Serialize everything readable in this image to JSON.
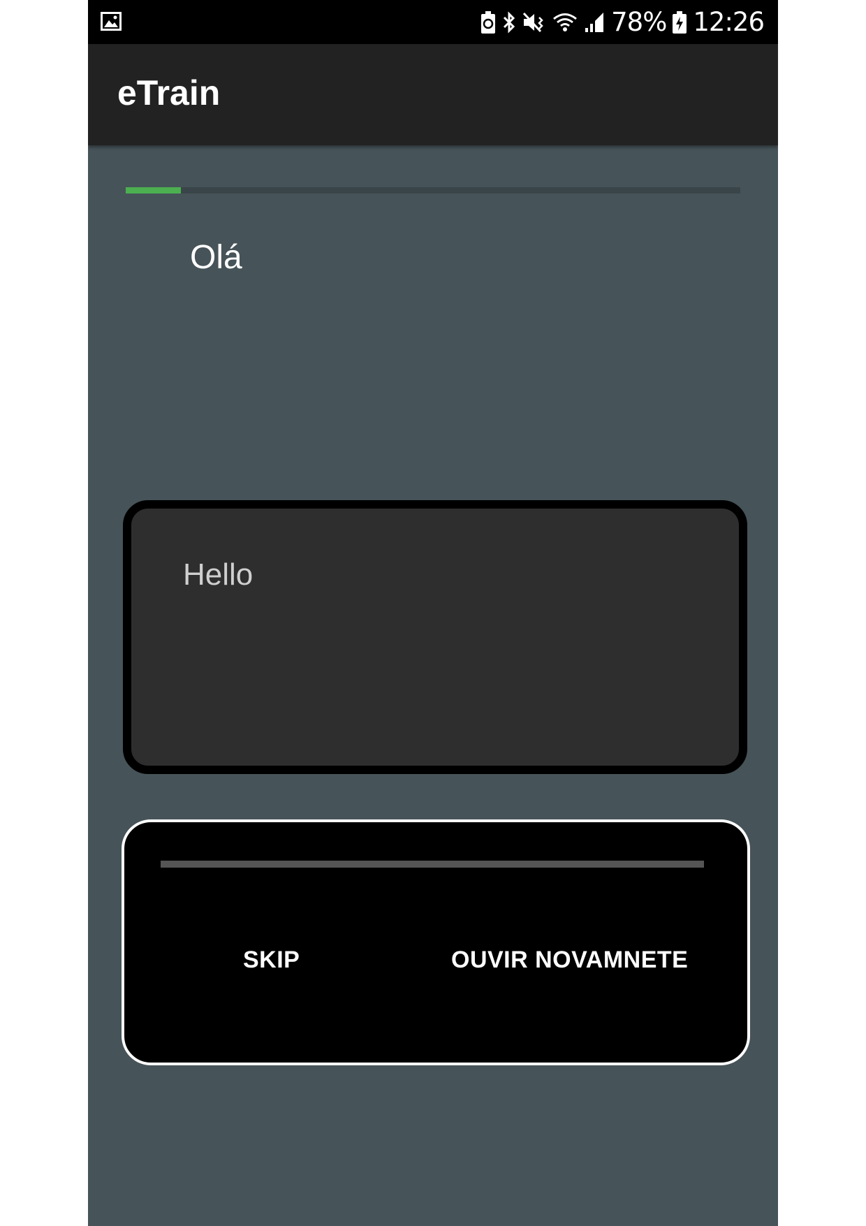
{
  "status_bar": {
    "left_icon": "image-notification-icon",
    "icons": [
      "battery-saver-icon",
      "bluetooth-icon",
      "mute-vibrate-icon",
      "wifi-icon",
      "signal-icon"
    ],
    "battery_percent": "78%",
    "battery_icon": "battery-charging-icon",
    "time": "12:26"
  },
  "app_bar": {
    "title": "eTrain"
  },
  "lesson": {
    "progress_fraction": 0.09,
    "progress_color": "#4caf50",
    "prompt_word": "Olá",
    "answer_text": "Hello"
  },
  "actions": {
    "audio_progress_fraction": 0,
    "skip_label": "SKIP",
    "replay_label": "OUVIR NOVAMNETE"
  },
  "colors": {
    "background": "#465358",
    "app_bar": "#222222",
    "status_bar": "#000000",
    "card": "#2e2e2e",
    "panel": "#000000"
  }
}
